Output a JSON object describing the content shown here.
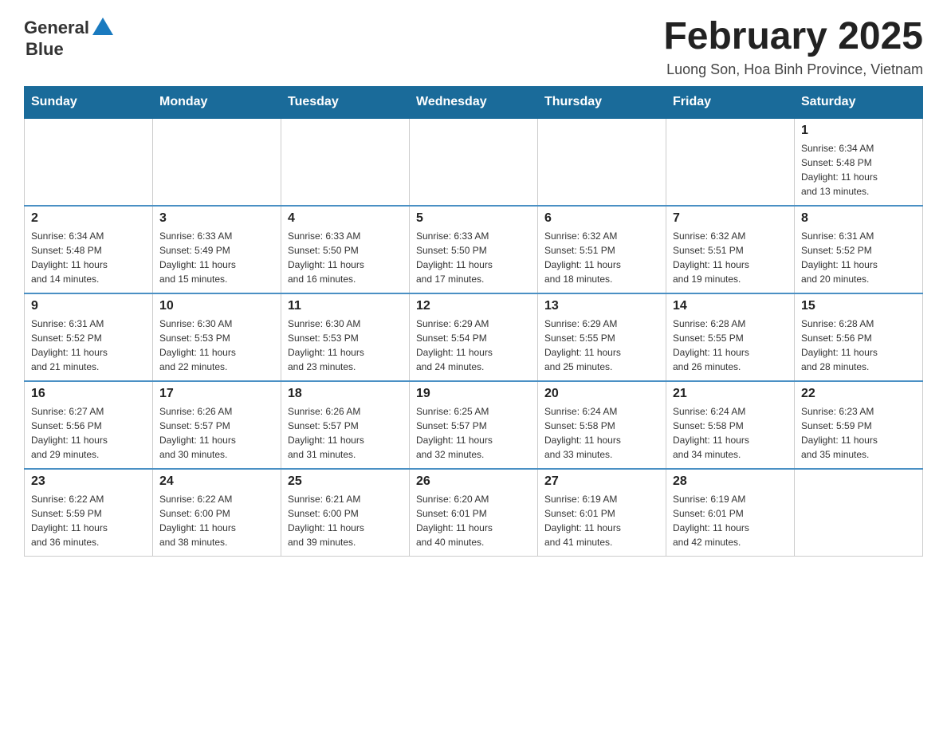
{
  "logo": {
    "text_general": "General",
    "text_blue": "Blue",
    "icon_shape": "triangle"
  },
  "header": {
    "title": "February 2025",
    "subtitle": "Luong Son, Hoa Binh Province, Vietnam"
  },
  "days_of_week": [
    "Sunday",
    "Monday",
    "Tuesday",
    "Wednesday",
    "Thursday",
    "Friday",
    "Saturday"
  ],
  "weeks": [
    {
      "cells": [
        {
          "day": "",
          "info": ""
        },
        {
          "day": "",
          "info": ""
        },
        {
          "day": "",
          "info": ""
        },
        {
          "day": "",
          "info": ""
        },
        {
          "day": "",
          "info": ""
        },
        {
          "day": "",
          "info": ""
        },
        {
          "day": "1",
          "info": "Sunrise: 6:34 AM\nSunset: 5:48 PM\nDaylight: 11 hours\nand 13 minutes."
        }
      ]
    },
    {
      "cells": [
        {
          "day": "2",
          "info": "Sunrise: 6:34 AM\nSunset: 5:48 PM\nDaylight: 11 hours\nand 14 minutes."
        },
        {
          "day": "3",
          "info": "Sunrise: 6:33 AM\nSunset: 5:49 PM\nDaylight: 11 hours\nand 15 minutes."
        },
        {
          "day": "4",
          "info": "Sunrise: 6:33 AM\nSunset: 5:50 PM\nDaylight: 11 hours\nand 16 minutes."
        },
        {
          "day": "5",
          "info": "Sunrise: 6:33 AM\nSunset: 5:50 PM\nDaylight: 11 hours\nand 17 minutes."
        },
        {
          "day": "6",
          "info": "Sunrise: 6:32 AM\nSunset: 5:51 PM\nDaylight: 11 hours\nand 18 minutes."
        },
        {
          "day": "7",
          "info": "Sunrise: 6:32 AM\nSunset: 5:51 PM\nDaylight: 11 hours\nand 19 minutes."
        },
        {
          "day": "8",
          "info": "Sunrise: 6:31 AM\nSunset: 5:52 PM\nDaylight: 11 hours\nand 20 minutes."
        }
      ]
    },
    {
      "cells": [
        {
          "day": "9",
          "info": "Sunrise: 6:31 AM\nSunset: 5:52 PM\nDaylight: 11 hours\nand 21 minutes."
        },
        {
          "day": "10",
          "info": "Sunrise: 6:30 AM\nSunset: 5:53 PM\nDaylight: 11 hours\nand 22 minutes."
        },
        {
          "day": "11",
          "info": "Sunrise: 6:30 AM\nSunset: 5:53 PM\nDaylight: 11 hours\nand 23 minutes."
        },
        {
          "day": "12",
          "info": "Sunrise: 6:29 AM\nSunset: 5:54 PM\nDaylight: 11 hours\nand 24 minutes."
        },
        {
          "day": "13",
          "info": "Sunrise: 6:29 AM\nSunset: 5:55 PM\nDaylight: 11 hours\nand 25 minutes."
        },
        {
          "day": "14",
          "info": "Sunrise: 6:28 AM\nSunset: 5:55 PM\nDaylight: 11 hours\nand 26 minutes."
        },
        {
          "day": "15",
          "info": "Sunrise: 6:28 AM\nSunset: 5:56 PM\nDaylight: 11 hours\nand 28 minutes."
        }
      ]
    },
    {
      "cells": [
        {
          "day": "16",
          "info": "Sunrise: 6:27 AM\nSunset: 5:56 PM\nDaylight: 11 hours\nand 29 minutes."
        },
        {
          "day": "17",
          "info": "Sunrise: 6:26 AM\nSunset: 5:57 PM\nDaylight: 11 hours\nand 30 minutes."
        },
        {
          "day": "18",
          "info": "Sunrise: 6:26 AM\nSunset: 5:57 PM\nDaylight: 11 hours\nand 31 minutes."
        },
        {
          "day": "19",
          "info": "Sunrise: 6:25 AM\nSunset: 5:57 PM\nDaylight: 11 hours\nand 32 minutes."
        },
        {
          "day": "20",
          "info": "Sunrise: 6:24 AM\nSunset: 5:58 PM\nDaylight: 11 hours\nand 33 minutes."
        },
        {
          "day": "21",
          "info": "Sunrise: 6:24 AM\nSunset: 5:58 PM\nDaylight: 11 hours\nand 34 minutes."
        },
        {
          "day": "22",
          "info": "Sunrise: 6:23 AM\nSunset: 5:59 PM\nDaylight: 11 hours\nand 35 minutes."
        }
      ]
    },
    {
      "cells": [
        {
          "day": "23",
          "info": "Sunrise: 6:22 AM\nSunset: 5:59 PM\nDaylight: 11 hours\nand 36 minutes."
        },
        {
          "day": "24",
          "info": "Sunrise: 6:22 AM\nSunset: 6:00 PM\nDaylight: 11 hours\nand 38 minutes."
        },
        {
          "day": "25",
          "info": "Sunrise: 6:21 AM\nSunset: 6:00 PM\nDaylight: 11 hours\nand 39 minutes."
        },
        {
          "day": "26",
          "info": "Sunrise: 6:20 AM\nSunset: 6:01 PM\nDaylight: 11 hours\nand 40 minutes."
        },
        {
          "day": "27",
          "info": "Sunrise: 6:19 AM\nSunset: 6:01 PM\nDaylight: 11 hours\nand 41 minutes."
        },
        {
          "day": "28",
          "info": "Sunrise: 6:19 AM\nSunset: 6:01 PM\nDaylight: 11 hours\nand 42 minutes."
        },
        {
          "day": "",
          "info": ""
        }
      ]
    }
  ]
}
